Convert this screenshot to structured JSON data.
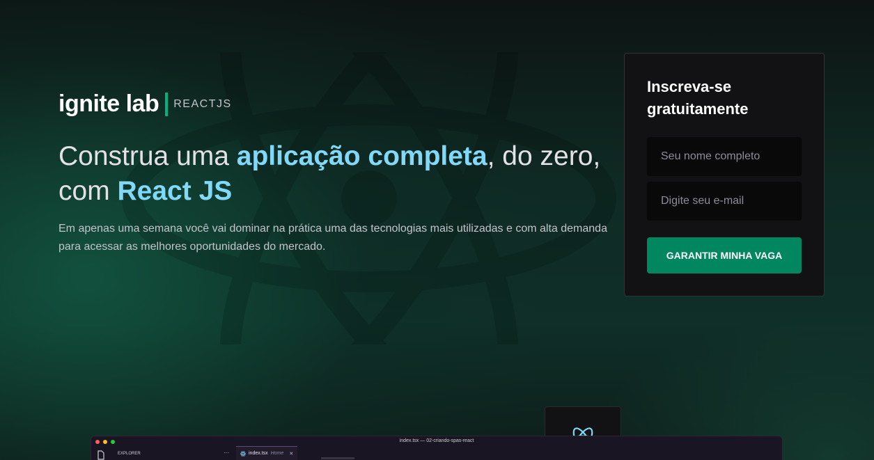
{
  "brand": {
    "name": "ignite lab",
    "tag": "REACTJS"
  },
  "hero": {
    "headline_part1": "Construa uma ",
    "headline_highlight1": "aplicação completa",
    "headline_part2": ", do zero, com ",
    "headline_highlight2": "React JS",
    "description": "Em apenas uma semana você vai dominar na prática uma das tecnologias mais utilizadas e com alta demanda para acessar as melhores oportunidades do mercado."
  },
  "signup": {
    "title": "Inscreva-se gratuitamente",
    "name_placeholder": "Seu nome completo",
    "email_placeholder": "Digite seu e-mail",
    "button_label": "GARANTIR MINHA VAGA"
  },
  "editor": {
    "window_title": "index.tsx — 02-criando-spas-react",
    "sidebar_title": "EXPLORER",
    "more_label": "···",
    "tab_file": "index.tsx",
    "tab_folder": "Home",
    "tab_close": "✕"
  },
  "colors": {
    "accent_green": "#00875f",
    "highlight_blue": "#81d8f7",
    "card_bg": "#121214",
    "input_bg": "#09090a"
  },
  "icons": {
    "background": "react-logo-icon",
    "badge": "react-logo-icon",
    "explorer": "files-icon"
  }
}
